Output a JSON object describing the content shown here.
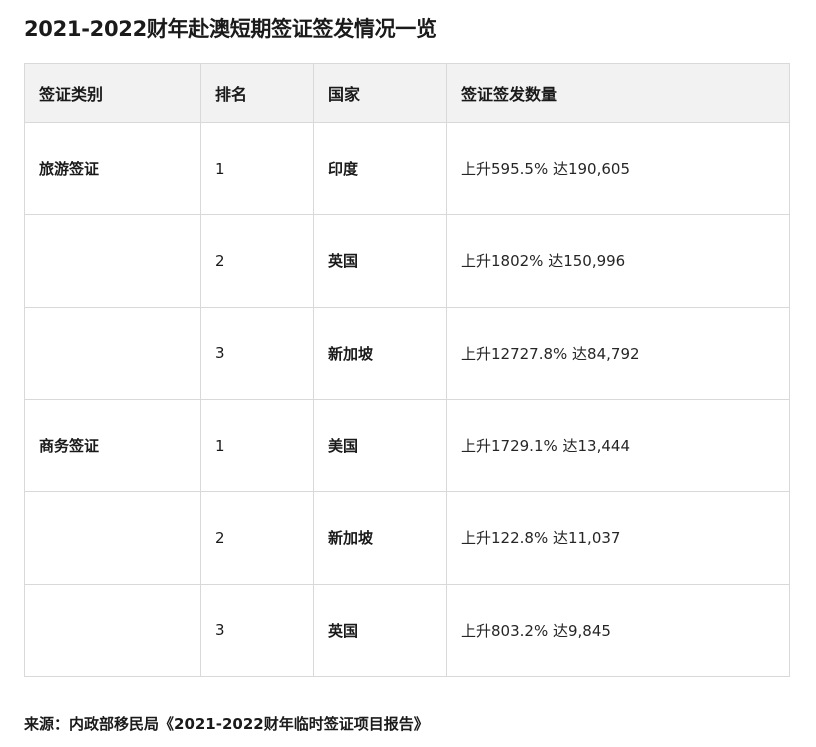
{
  "title": "2021-2022财年赴澳短期签证签发情况一览",
  "table": {
    "headers": [
      "签证类别",
      "排名",
      "国家",
      "签证签发数量"
    ],
    "rows": [
      {
        "category": "旅游签证",
        "rank": "1",
        "country": "印度",
        "count": "上升595.5% 达190,605"
      },
      {
        "category": "",
        "rank": "2",
        "country": "英国",
        "count": "上升1802% 达150,996"
      },
      {
        "category": "",
        "rank": "3",
        "country": "新加坡",
        "count": "上升12727.8% 达84,792"
      },
      {
        "category": "商务签证",
        "rank": "1",
        "country": "美国",
        "count": "上升1729.1% 达13,444"
      },
      {
        "category": "",
        "rank": "2",
        "country": "新加坡",
        "count": "上升122.8% 达11,037"
      },
      {
        "category": "",
        "rank": "3",
        "country": "英国",
        "count": "上升803.2% 达9,845"
      }
    ]
  },
  "source": "来源：内政部移民局《2021-2022财年临时签证项目报告》"
}
